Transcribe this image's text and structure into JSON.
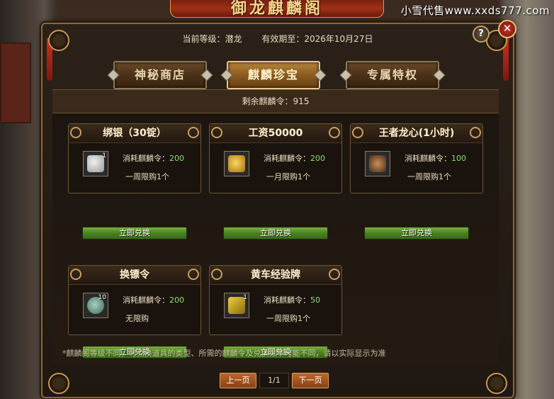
{
  "watermark": "小雪代售www.xxds777.com",
  "window": {
    "title": "御龙麒麟阁"
  },
  "header": {
    "level_label": "当前等级：潜龙",
    "expiry_label": "有效期至：2026年10月27日",
    "help_symbol": "?",
    "close_symbol": "✕"
  },
  "tabs": [
    {
      "label": "神秘商店",
      "active": false
    },
    {
      "label": "麒麟珍宝",
      "active": true
    },
    {
      "label": "专属特权",
      "active": false
    }
  ],
  "remaining": "剩余麒麟令：915",
  "cost_prefix": "消耗麒麟令：",
  "items": [
    {
      "name": "绑银（30锭）",
      "qty": "1",
      "cost": "200",
      "limit": "一周限购1个",
      "redeem": "立即兑换",
      "icon": "silver-ingot-icon",
      "color": "#c8c8c8"
    },
    {
      "name": "工资50000",
      "qty": "",
      "cost": "200",
      "limit": "一月限购1个",
      "redeem": "立即兑换",
      "icon": "gold-coins-icon",
      "color": "#d8a830"
    },
    {
      "name": "王者龙心(1小时)",
      "qty": "",
      "cost": "100",
      "limit": "一周限购1个",
      "redeem": "立即兑换",
      "icon": "dragon-heart-icon",
      "color": "#a06a40"
    },
    {
      "name": "换镖令",
      "qty": "10",
      "cost": "200",
      "limit": "无限购",
      "redeem": "立即兑换",
      "icon": "escort-token-icon",
      "color": "#6a9a8a"
    },
    {
      "name": "黄车经验牌",
      "qty": "1",
      "cost": "50",
      "limit": "一周限购1个",
      "redeem": "立即兑换",
      "icon": "yellow-cart-plate-icon",
      "color": "#c8a020"
    }
  ],
  "note": "*麒麟阁等级不同，可兑换道具的类型、所需的麒麟令及兑换频率可能不同，请以实际显示为准",
  "pager": {
    "prev": "上一页",
    "page": "1/1",
    "next": "下一页"
  }
}
